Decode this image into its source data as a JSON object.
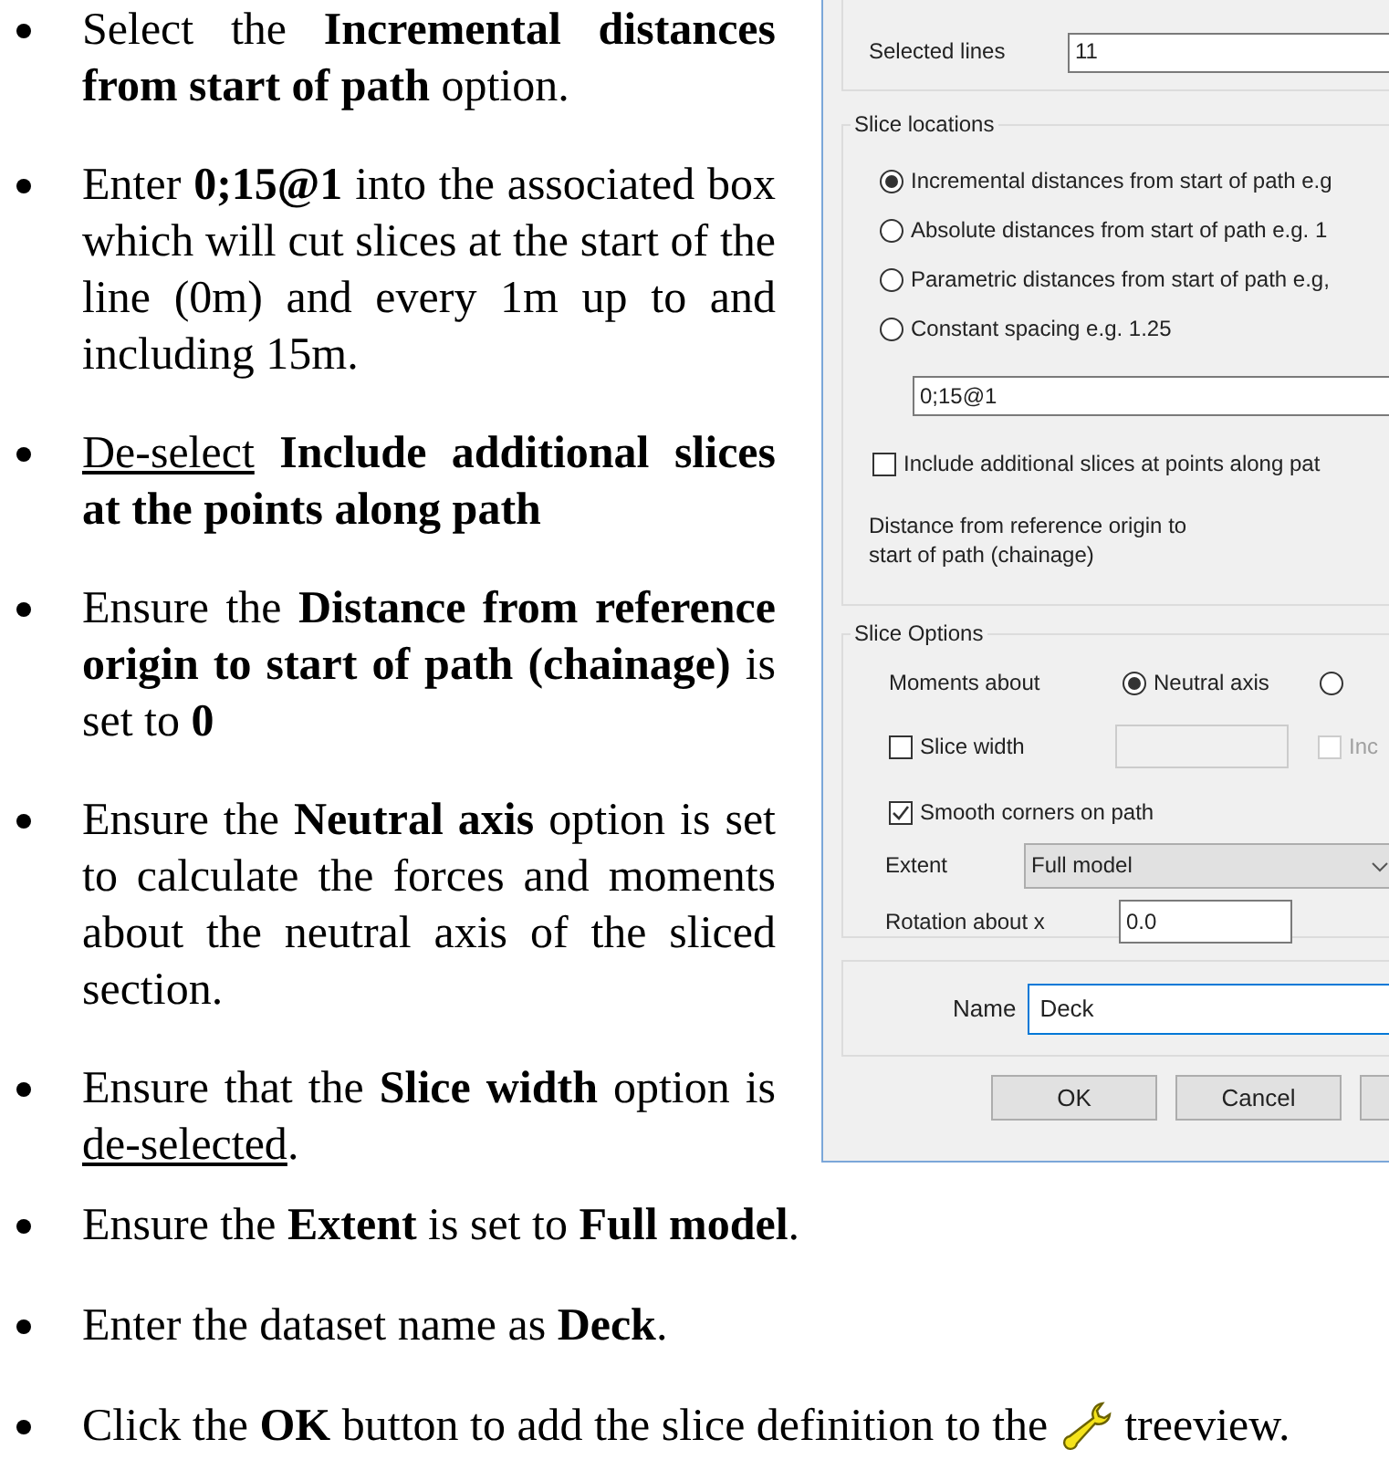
{
  "instructions_top": [
    {
      "segments": [
        {
          "text": "Select the **Incremental distances from start of path** option.",
          "underlined": false
        }
      ]
    },
    {
      "segments": [
        {
          "text": "Enter **0;15@1** into the associated box which will cut slices at the start of the line (0m) and every 1m up to and including 15m.",
          "underlined": false
        }
      ]
    },
    {
      "segments": [
        {
          "text": "De-select",
          "underlined": true
        },
        {
          "text": " **Include additional slices at the points along path**",
          "underlined": false
        }
      ]
    },
    {
      "segments": [
        {
          "text": "Ensure the **Distance from reference origin to start of path (chainage)** is set to **0**",
          "underlined": false
        }
      ]
    },
    {
      "segments": [
        {
          "text": "Ensure the **Neutral axis** option is set to calculate the forces and moments about the neutral axis of the sliced section.",
          "underlined": false
        }
      ]
    },
    {
      "segments": [
        {
          "text": "Ensure that the **Slice width** option is ",
          "underlined": false
        },
        {
          "text": "de-selected",
          "underlined": true
        },
        {
          "text": ".",
          "underlined": false
        }
      ]
    }
  ],
  "dialog": {
    "slice_path": {
      "label": "Selected lines",
      "value": "11"
    },
    "slice_locations": {
      "title": "Slice locations",
      "options": [
        {
          "label": "Incremental distances from start of path e.g",
          "selected": true
        },
        {
          "label": "Absolute distances from start of path e.g. 1",
          "selected": false
        },
        {
          "label": "Parametric distances from start of path e.g,",
          "selected": false
        },
        {
          "label": "Constant spacing e.g. 1.25",
          "selected": false
        }
      ],
      "value": "0;15@1",
      "include_additional": {
        "label": "Include additional slices at points along pat",
        "checked": false
      },
      "chainage_label": "Distance from reference origin to start of path (chainage)"
    },
    "slice_options": {
      "title": "Slice Options",
      "moments_label": "Moments about",
      "moments_options": [
        {
          "label": "Neutral axis",
          "selected": true
        },
        {
          "selected": false
        }
      ],
      "slice_width": {
        "label": "Slice width",
        "checked": false
      },
      "include": {
        "label": "Inc",
        "checked": false,
        "disabled": true
      },
      "smooth_corners": {
        "label": "Smooth corners on path",
        "checked": true
      },
      "extent_label": "Extent",
      "extent_value": "Full model",
      "rotation_label": "Rotation about x",
      "rotation_value": "0.0"
    },
    "name_label": "Name",
    "name_value": "Deck",
    "buttons": [
      "OK",
      "Cancel"
    ]
  },
  "instructions_bottom": [
    {
      "segments": [
        {
          "text": "Ensure the **Extent** is set to **Full model**.",
          "underlined": false
        }
      ]
    },
    {
      "segments": [
        {
          "text": "Enter the dataset name as **Deck**.",
          "underlined": false
        }
      ]
    },
    {
      "segments": [
        {
          "text": "Click the **OK** button to add the slice definition to the",
          "underlined": false
        }
      ],
      "after": "treeview."
    }
  ]
}
